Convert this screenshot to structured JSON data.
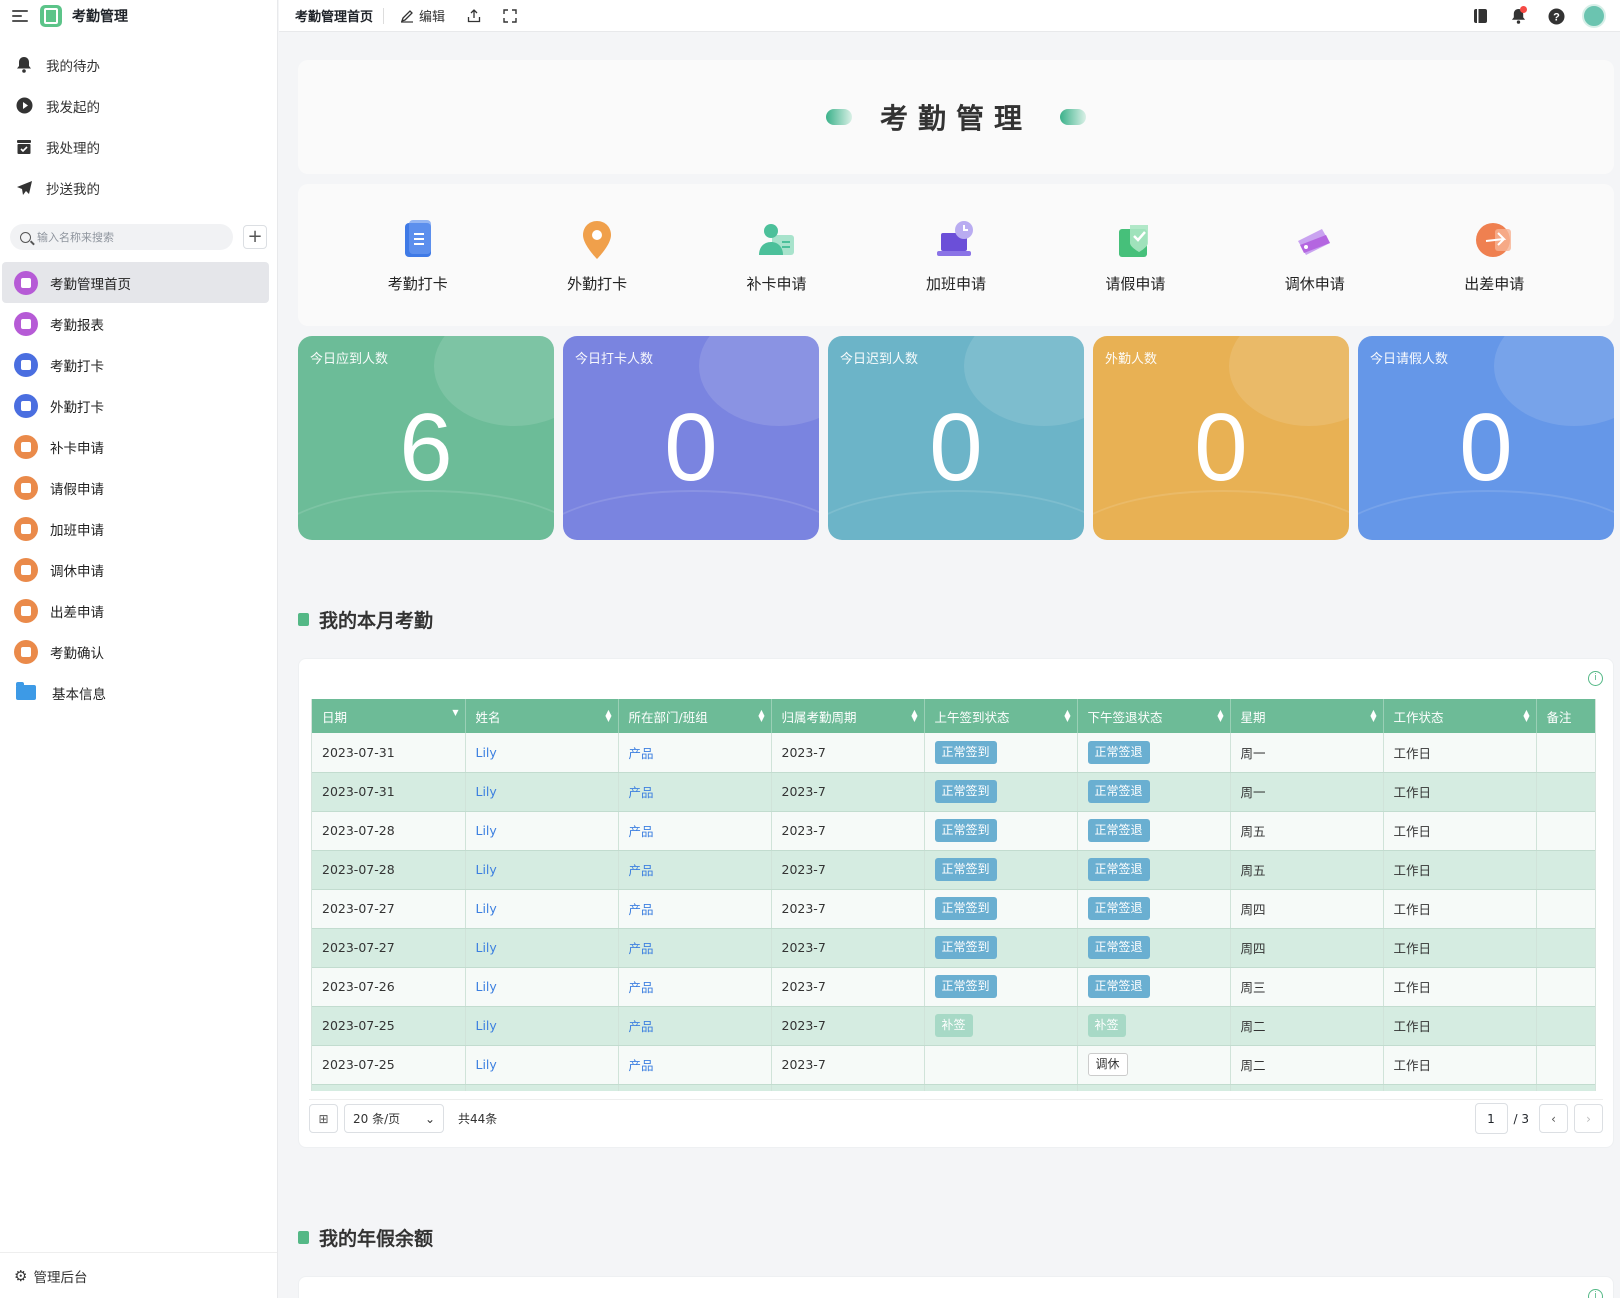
{
  "app": {
    "title": "考勤管理"
  },
  "quick_links": [
    {
      "label": "我的待办",
      "icon": "bell-icon"
    },
    {
      "label": "我发起的",
      "icon": "play-circle-icon"
    },
    {
      "label": "我处理的",
      "icon": "inbox-check-icon"
    },
    {
      "label": "抄送我的",
      "icon": "send-icon"
    }
  ],
  "search": {
    "placeholder": "输入名称来搜索"
  },
  "nav": [
    {
      "label": "考勤管理首页",
      "color": "purple",
      "active": true
    },
    {
      "label": "考勤报表",
      "color": "purple"
    },
    {
      "label": "考勤打卡",
      "color": "blue"
    },
    {
      "label": "外勤打卡",
      "color": "blue"
    },
    {
      "label": "补卡申请",
      "color": "orange"
    },
    {
      "label": "请假申请",
      "color": "orange"
    },
    {
      "label": "加班申请",
      "color": "orange"
    },
    {
      "label": "调休申请",
      "color": "orange"
    },
    {
      "label": "出差申请",
      "color": "orange"
    },
    {
      "label": "考勤确认",
      "color": "orange"
    },
    {
      "label": "基本信息",
      "color": "folder"
    }
  ],
  "footer": {
    "label": "管理后台"
  },
  "topbar": {
    "title": "考勤管理首页",
    "edit": "编辑"
  },
  "page": {
    "title": "考勤管理"
  },
  "apps": [
    {
      "label": "考勤打卡",
      "icon": "clipboard-icon",
      "color": "#3f7ae6"
    },
    {
      "label": "外勤打卡",
      "icon": "location-pin-icon",
      "color": "#f0a04b"
    },
    {
      "label": "补卡申请",
      "icon": "user-card-icon",
      "color": "#4cc09a"
    },
    {
      "label": "加班申请",
      "icon": "laptop-clock-icon",
      "color": "#6b4fd8"
    },
    {
      "label": "请假申请",
      "icon": "check-shield-icon",
      "color": "#46c07a"
    },
    {
      "label": "调休申请",
      "icon": "ticket-icon",
      "color": "#b466e0"
    },
    {
      "label": "出差申请",
      "icon": "plane-icon",
      "color": "#ef8050"
    }
  ],
  "stats": [
    {
      "label": "今日应到人数",
      "value": "6",
      "color": "#6cbc98"
    },
    {
      "label": "今日打卡人数",
      "value": "0",
      "color": "#7a84e0"
    },
    {
      "label": "今日迟到人数",
      "value": "0",
      "color": "#6cb4c8"
    },
    {
      "label": "外勤人数",
      "value": "0",
      "color": "#e8b154"
    },
    {
      "label": "今日请假人数",
      "value": "0",
      "color": "#6597e8"
    }
  ],
  "section1": {
    "title": "我的本月考勤"
  },
  "table": {
    "columns": [
      "日期",
      "姓名",
      "所在部门/班组",
      "归属考勤周期",
      "上午签到状态",
      "下午签退状态",
      "星期",
      "工作状态",
      "备注"
    ],
    "rows": [
      {
        "date": "2023-07-31",
        "name": "Lily",
        "dept": "产品",
        "period": "2023-7",
        "am": "正常签到",
        "pm": "正常签退",
        "weekday": "周一",
        "status": "工作日"
      },
      {
        "date": "2023-07-31",
        "name": "Lily",
        "dept": "产品",
        "period": "2023-7",
        "am": "正常签到",
        "pm": "正常签退",
        "weekday": "周一",
        "status": "工作日"
      },
      {
        "date": "2023-07-28",
        "name": "Lily",
        "dept": "产品",
        "period": "2023-7",
        "am": "正常签到",
        "pm": "正常签退",
        "weekday": "周五",
        "status": "工作日"
      },
      {
        "date": "2023-07-28",
        "name": "Lily",
        "dept": "产品",
        "period": "2023-7",
        "am": "正常签到",
        "pm": "正常签退",
        "weekday": "周五",
        "status": "工作日"
      },
      {
        "date": "2023-07-27",
        "name": "Lily",
        "dept": "产品",
        "period": "2023-7",
        "am": "正常签到",
        "pm": "正常签退",
        "weekday": "周四",
        "status": "工作日"
      },
      {
        "date": "2023-07-27",
        "name": "Lily",
        "dept": "产品",
        "period": "2023-7",
        "am": "正常签到",
        "pm": "正常签退",
        "weekday": "周四",
        "status": "工作日"
      },
      {
        "date": "2023-07-26",
        "name": "Lily",
        "dept": "产品",
        "period": "2023-7",
        "am": "正常签到",
        "pm": "正常签退",
        "weekday": "周三",
        "status": "工作日"
      },
      {
        "date": "2023-07-25",
        "name": "Lily",
        "dept": "产品",
        "period": "2023-7",
        "am": "补签",
        "pm": "补签",
        "weekday": "周二",
        "status": "工作日"
      },
      {
        "date": "2023-07-25",
        "name": "Lily",
        "dept": "产品",
        "period": "2023-7",
        "am": "",
        "pm": "调休",
        "weekday": "周二",
        "status": "工作日"
      }
    ]
  },
  "pager": {
    "page_size": "20 条/页",
    "total": "共44条",
    "current": "1",
    "of": "/ 3"
  },
  "section2": {
    "title": "我的年假余额"
  }
}
